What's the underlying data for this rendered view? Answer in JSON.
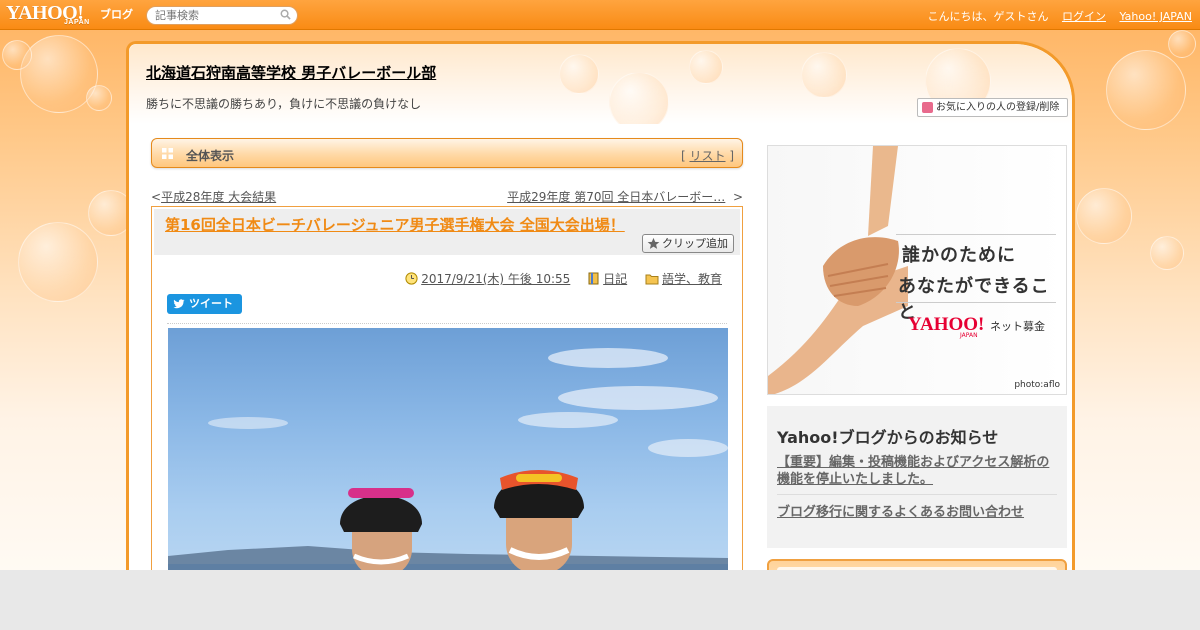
{
  "header": {
    "logo_text": "YAHOO!",
    "logo_sub": "JAPAN",
    "service_name": "ブログ",
    "search_placeholder": "記事検索",
    "greeting": "こんにちは、ゲストさん",
    "login_link": "ログイン",
    "yahoo_link": "Yahoo! JAPAN"
  },
  "blog": {
    "title": "北海道石狩南高等学校 男子バレーボール部",
    "description": "勝ちに不思議の勝ちあり，負けに不思議の負けなし",
    "favorite_button": "お気に入りの人の登録/削除"
  },
  "category_bar": {
    "label": "全体表示",
    "list_open": "[ ",
    "list_link": "リスト",
    "list_close": " ]"
  },
  "navigation": {
    "prev_prefix": "<",
    "prev_label": "平成28年度 大会結果",
    "next_label": "平成29年度 第70回 全日本バレーボー…",
    "next_suffix": "  >"
  },
  "article": {
    "title": "第16回全日本ビーチバレージュニア男子選手権大会 全国大会出場！",
    "clip_button": "クリップ追加",
    "datetime": "2017/9/21(木) 午後 10:55",
    "category": "日記",
    "folder": "語学、教育",
    "tweet_button": "ツイート"
  },
  "sidebar": {
    "ad": {
      "line1": "誰かのために",
      "line2": "あなたができること",
      "brand": "YAHOO!",
      "brand_sub": "JAPAN",
      "service": "ネット募金",
      "credit": "photo:aflo"
    },
    "notice": {
      "heading": "Yahoo!ブログからのお知らせ",
      "items": [
        "【重要】編集・投稿機能およびアクセス解析の機能を停止いたしました。",
        "ブログ移行に関するよくあるお問い合わせ"
      ]
    }
  },
  "colors": {
    "accent": "#f39a2a",
    "title_orange": "#f08a14",
    "tweet_blue": "#1b95e0",
    "brand_red": "#e60033"
  }
}
